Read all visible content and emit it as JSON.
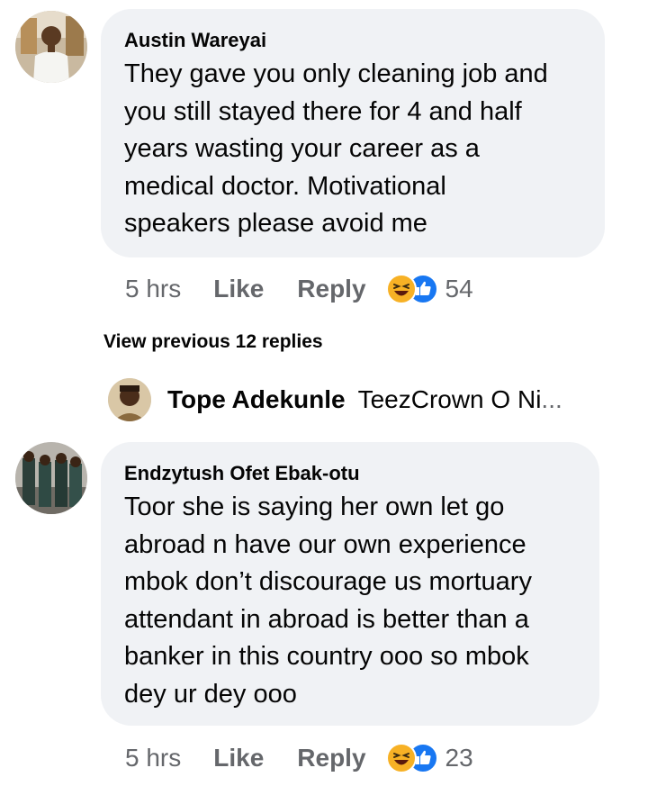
{
  "comments": [
    {
      "author": "Austin Wareyai",
      "text_lines": [
        "They gave you only cleaning job and",
        "you still stayed there for 4 and half",
        "years wasting your career as a",
        "medical doctor. Motivational",
        "speakers please avoid me"
      ],
      "time": "5 hrs",
      "like_label": "Like",
      "reply_label": "Reply",
      "reaction_count": "54",
      "reactions": [
        "haha-icon",
        "like-icon"
      ]
    },
    {
      "author": "Endzytush Ofet Ebak-otu",
      "text_lines": [
        "Toor she is saying her own let go",
        "abroad n have our own experience",
        "mbok don’t discourage us mortuary",
        "attendant in abroad is better than a",
        "banker in this country ooo so mbok",
        "dey ur dey ooo"
      ],
      "time": "5 hrs",
      "like_label": "Like",
      "reply_label": "Reply",
      "reaction_count": "23",
      "reactions": [
        "haha-icon",
        "like-icon"
      ]
    }
  ],
  "view_previous": "View previous 12 replies",
  "reply_preview": {
    "author": "Tope Adekunle",
    "snippet": "TeezCrown O Ni",
    "ellipsis": "..."
  },
  "colors": {
    "bubble": "#f0f2f5",
    "meta_text": "#65676b",
    "like_blue": "#1877f2",
    "haha_yellow": "#f7b125"
  }
}
